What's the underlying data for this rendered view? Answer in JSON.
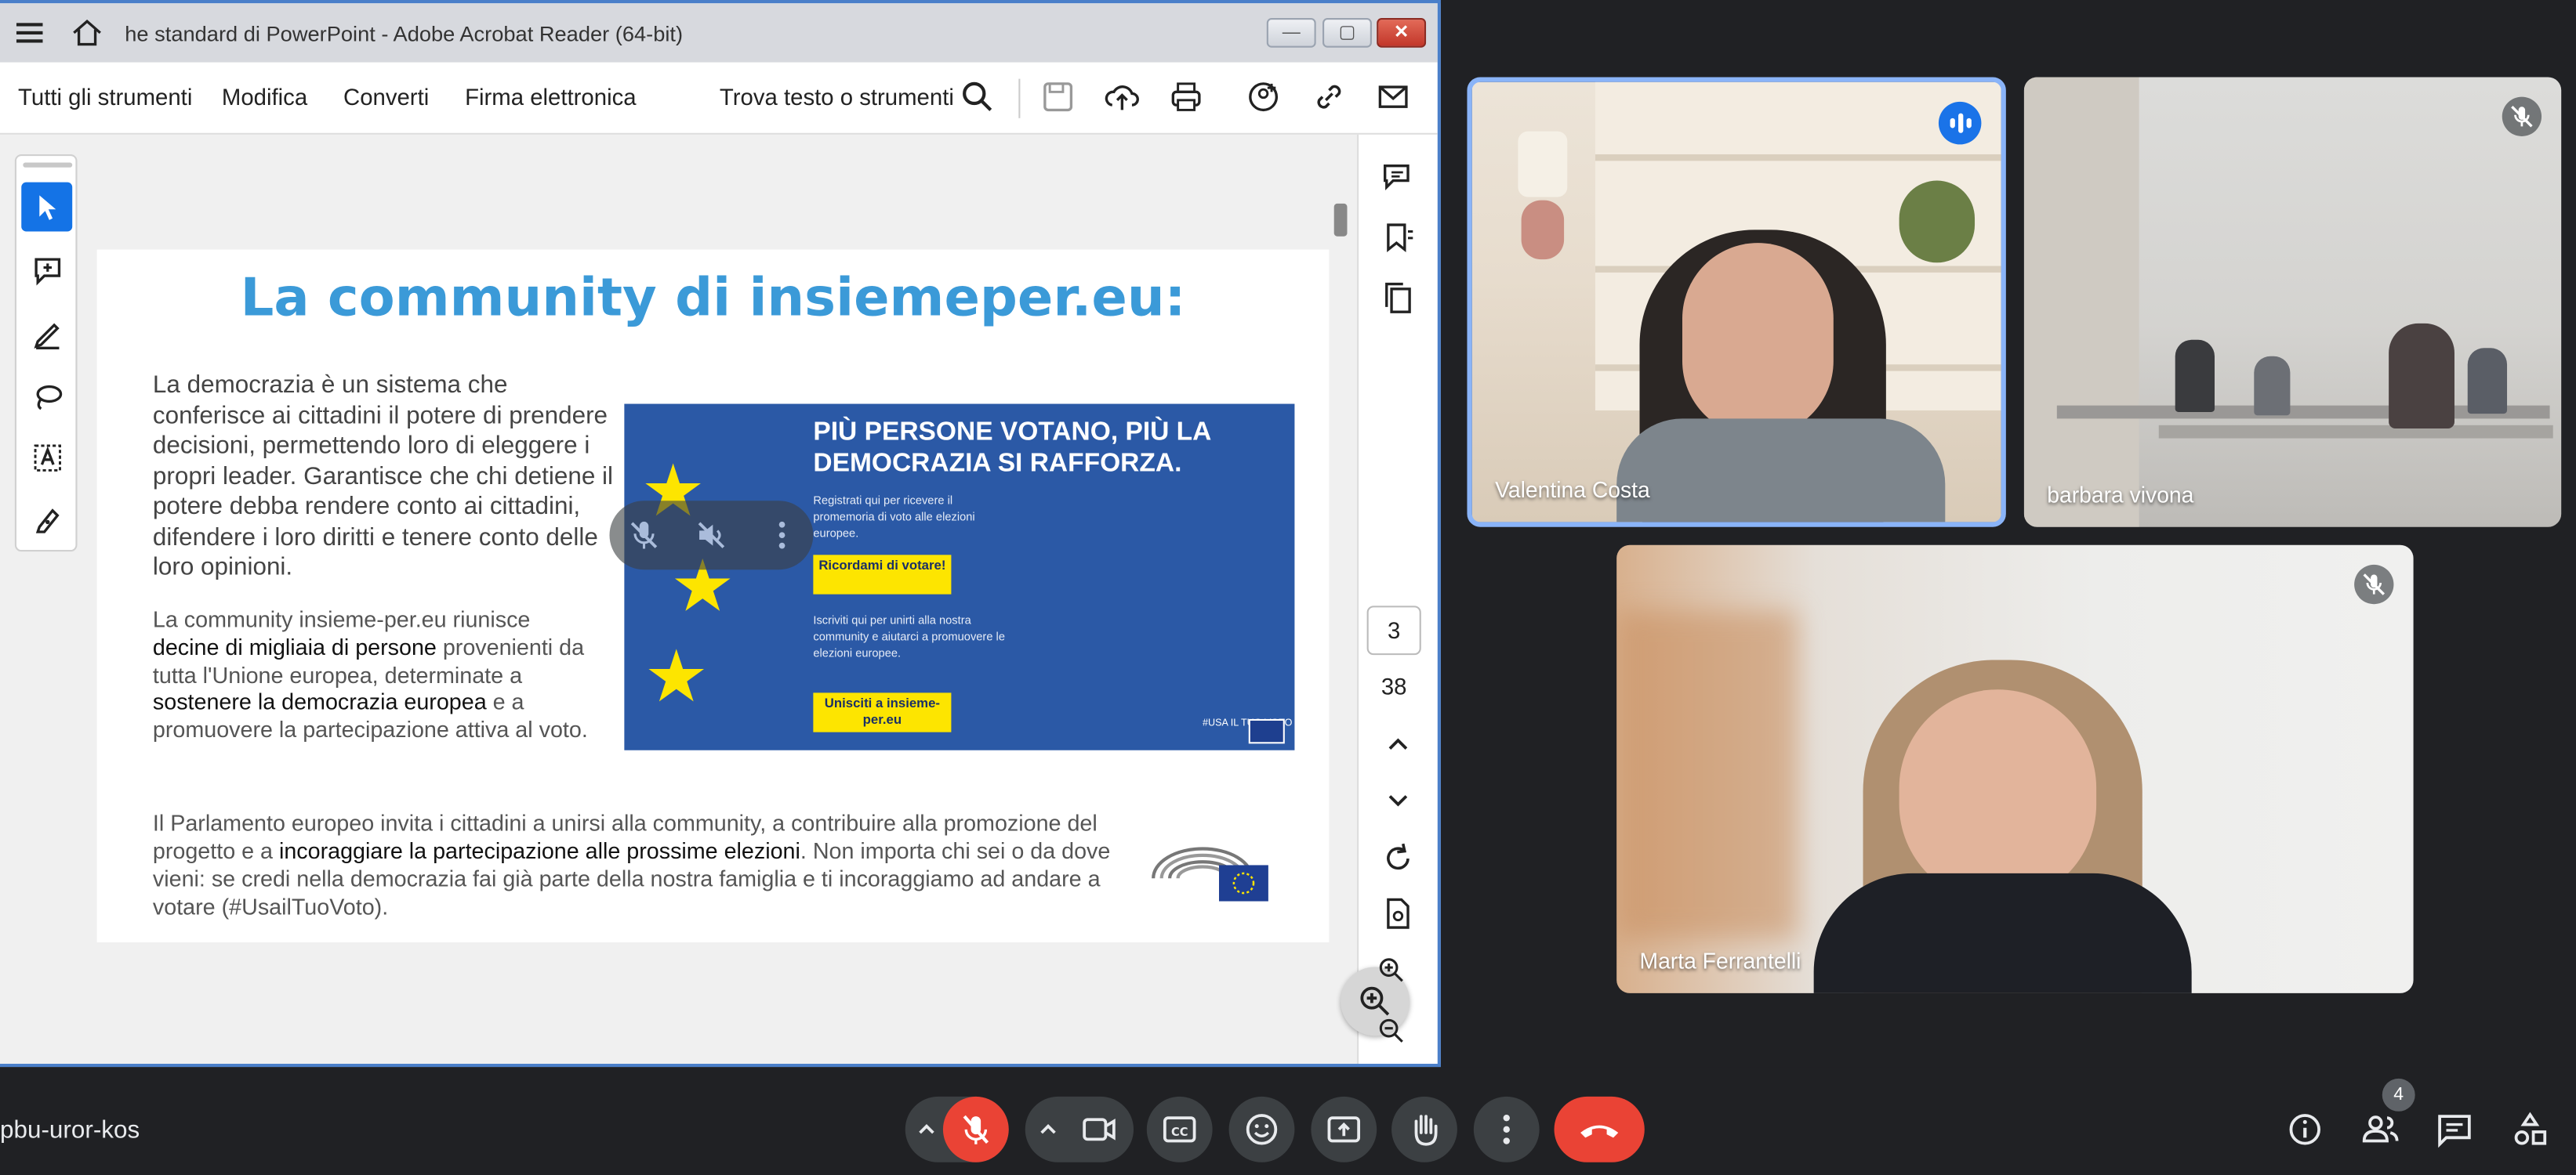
{
  "acrobat": {
    "window_title": "he standard di PowerPoint - Adobe Acrobat Reader (64-bit)",
    "menu": [
      "Tutti gli strumenti",
      "Modifica",
      "Converti",
      "Firma elettronica"
    ],
    "search_label": "Trova testo o strumenti",
    "page_current": "3",
    "page_total": "38"
  },
  "slide": {
    "title": "La community di insiemeper.eu:",
    "para1": "La democrazia è un sistema che conferisce ai cittadini il potere di prendere decisioni, permettendo loro di eleggere i propri leader. Garantisce che chi detiene il potere debba rendere conto ai cittadini, difendere i loro diritti e tenere conto delle loro opinioni.",
    "para2_a": "La community insieme-per.eu riunisce ",
    "para2_b": "decine di migliaia di persone",
    "para2_c": " provenienti da tutta l'Unione europea, determinate a ",
    "para2_d": "sostenere la democrazia europea",
    "para2_e": " e a promuovere la partecipazione attiva al voto.",
    "para3_a": "Il Parlamento europeo invita i cittadini a unirsi alla community, a contribuire alla promozione del progetto e a ",
    "para3_b": "incoraggiare la partecipazione alle prossime elezioni",
    "para3_c": ". Non importa chi sei o da dove vieni: se credi nella democrazia fai già parte della nostra famiglia e ti incoraggiamo ad andare a votare (#UsailTuoVoto).",
    "banner": {
      "headline": "PIÙ PERSONE VOTANO, PIÙ LA DEMOCRAZIA SI RAFFORZA.",
      "text1": "Registrati qui per ricevere il promemoria di voto alle elezioni europee.",
      "button1": "Ricordami di votare!",
      "text2": "Iscriviti qui per unirti alla nostra community e aiutarci a promuovere le elezioni europee.",
      "button2": "Unisciti a insieme-per.eu",
      "footer": "#USA IL TUO VOTO"
    }
  },
  "meet": {
    "meeting_code": "pbu-uror-kos",
    "participants_count": "4",
    "tiles": [
      {
        "name": "Valentina Costa",
        "speaking": true
      },
      {
        "name": "barbara vivona",
        "muted": true
      },
      {
        "name": "Marta Ferrantelli",
        "muted": true
      }
    ],
    "accent": "#1a73e8",
    "end_call_color": "#ea4335"
  }
}
